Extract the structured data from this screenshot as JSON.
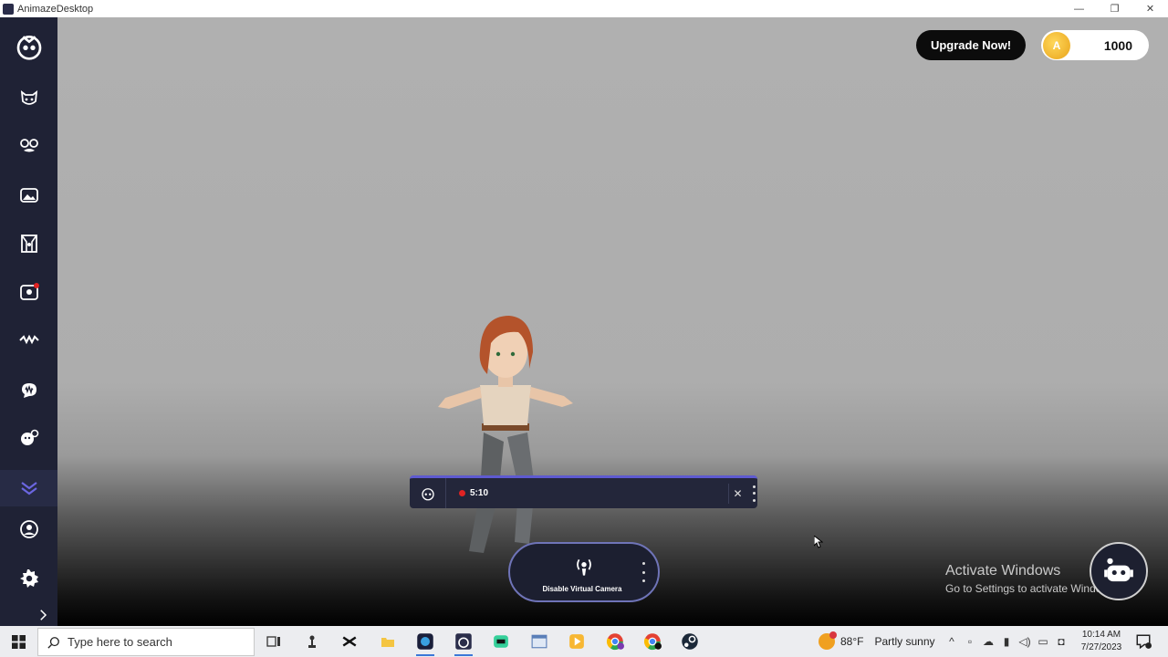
{
  "window": {
    "title": "AnimazeDesktop",
    "minimize": "—",
    "maximize": "❐",
    "close": "✕"
  },
  "sidebar": {
    "items": [
      {
        "name": "animaze-logo-icon"
      },
      {
        "name": "avatars-icon"
      },
      {
        "name": "props-icon"
      },
      {
        "name": "backgrounds-icon"
      },
      {
        "name": "scenes-icon"
      },
      {
        "name": "emotes-icon"
      },
      {
        "name": "idle-animations-icon"
      },
      {
        "name": "audio-icon"
      },
      {
        "name": "tracking-icon"
      },
      {
        "name": "special-actions-icon"
      },
      {
        "name": "profile-icon"
      },
      {
        "name": "settings-icon"
      },
      {
        "name": "expand-icon"
      }
    ],
    "active_index": 9
  },
  "header": {
    "upgrade_label": "Upgrade Now!",
    "coin_count": "1000"
  },
  "recorder": {
    "time": "5:10",
    "close": "✕"
  },
  "virtual_camera": {
    "label": "Disable Virtual Camera"
  },
  "watermark": {
    "line1": "Activate Windows",
    "line2": "Go to Settings to activate Windows."
  },
  "taskbar": {
    "search_placeholder": "Type here to search",
    "weather_temp": "88°F",
    "weather_condition": "Partly sunny",
    "time": "10:14 AM",
    "date": "7/27/2023"
  },
  "colors": {
    "sidebar_bg": "#1f2235",
    "accent": "#5e5ad0",
    "record_red": "#e02323",
    "coin_gold": "#f0b428"
  }
}
